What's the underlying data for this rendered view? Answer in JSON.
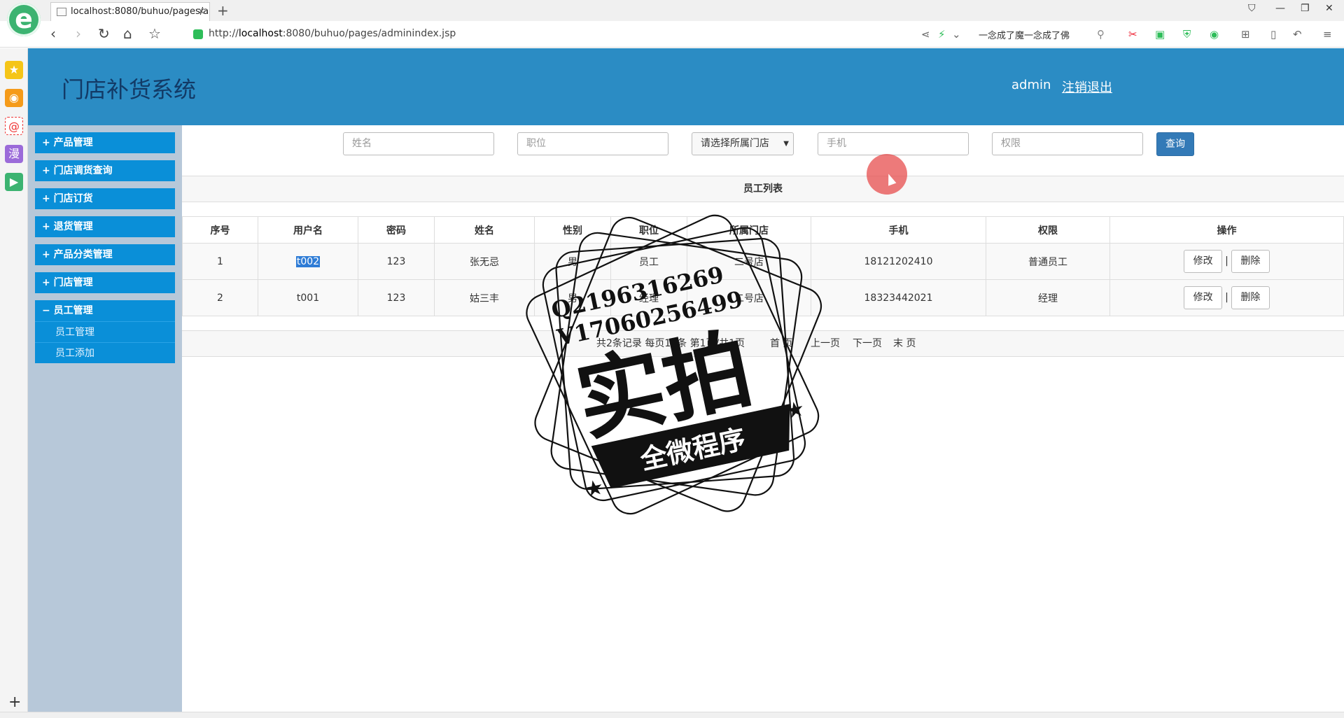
{
  "browser": {
    "tab_title": "localhost:8080/buhuo/pages/a",
    "url_prefix": "http://",
    "url_host": "localhost",
    "url_rest": ":8080/buhuo/pages/adminindex.jsp",
    "search_text": "一念成了魔一念成了佛",
    "logo_glyph": "e",
    "new_tab_glyph": "+",
    "close_glyph": "×"
  },
  "header": {
    "title": "门店补货系统",
    "user": "admin",
    "logout": "注销退出"
  },
  "sidebar": {
    "items": [
      {
        "label": "+ 产品管理"
      },
      {
        "label": "+ 门店调货查询"
      },
      {
        "label": "+ 门店订货"
      },
      {
        "label": "+ 退货管理"
      },
      {
        "label": "+ 产品分类管理"
      },
      {
        "label": "+ 门店管理"
      },
      {
        "label": "− 员工管理"
      }
    ],
    "subitems": [
      {
        "label": "员工管理"
      },
      {
        "label": "员工添加"
      }
    ]
  },
  "filters": {
    "name_placeholder": "姓名",
    "position_placeholder": "职位",
    "store_select": "请选择所属门店",
    "phone_placeholder": "手机",
    "permission_placeholder": "权限",
    "query_label": "查询"
  },
  "list_title": "员工列表",
  "table": {
    "headers": [
      "序号",
      "用户名",
      "密码",
      "姓名",
      "性别",
      "职位",
      "所属门店",
      "手机",
      "权限",
      "操作"
    ],
    "rows": [
      {
        "no": "1",
        "username": "t002",
        "password": "123",
        "name": "张无忌",
        "gender": "男",
        "position": "员工",
        "store": "二号店",
        "phone": "18121202410",
        "permission": "普通员工"
      },
      {
        "no": "2",
        "username": "t001",
        "password": "123",
        "name": "姑三丰",
        "gender": "男",
        "position": "经理",
        "store": "二号店",
        "phone": "18323442021",
        "permission": "经理"
      }
    ],
    "edit_label": "修改",
    "delete_label": "删除",
    "separator": "|"
  },
  "pager": {
    "summary": "共2条记录 每页10条 第1页/共1页",
    "first": "首 页",
    "prev": "上一页",
    "next": "下一页",
    "last": "末 页"
  },
  "watermark": {
    "qq": "Q2196316269",
    "wx": "V17060256499",
    "big_text": "实拍",
    "banner": "全微程序"
  }
}
